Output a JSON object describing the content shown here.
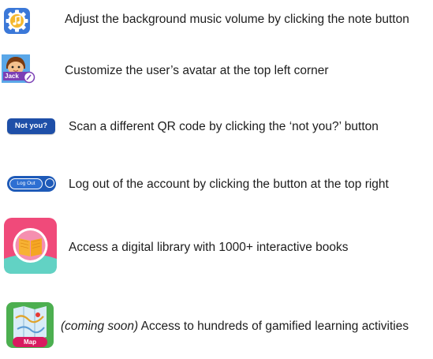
{
  "features": [
    {
      "icon": "music-note-gear-icon",
      "text": "Adjust the background music volume by clicking the note button"
    },
    {
      "icon": "avatar-icon",
      "icon_label": "Jack",
      "text": "Customize the user’s avatar at the top left corner"
    },
    {
      "icon": "not-you-button-icon",
      "icon_label": "Not you?",
      "text": "Scan a different QR code by clicking the ‘not you?’ button"
    },
    {
      "icon": "logout-button-icon",
      "icon_label": "Log Out",
      "text": "Log out of the account by clicking the button at the top right"
    },
    {
      "icon": "library-book-icon",
      "text": "Access a digital library with 1000+ interactive books"
    },
    {
      "icon": "map-icon",
      "icon_label": "Map",
      "text_prefix": "(coming soon)",
      "text": " Access to hundreds of gamified learning activities"
    }
  ],
  "colors": {
    "music_bg": "#3b78d8",
    "music_note": "#f5b82e",
    "button_blue": "#1e4fa8",
    "library_pink": "#f04a7a",
    "library_teal": "#62d2c4",
    "map_green": "#4caf50",
    "map_label": "#d81b60"
  }
}
